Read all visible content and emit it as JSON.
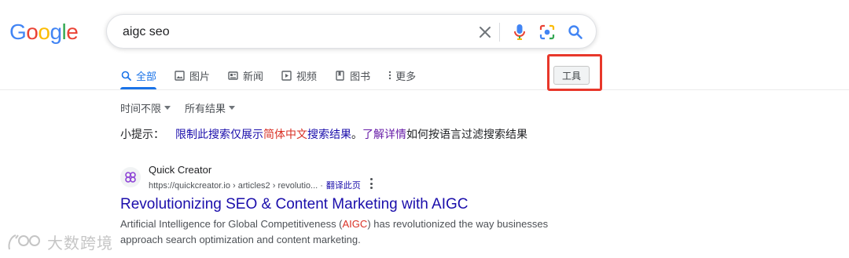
{
  "logo": {
    "letters": [
      "G",
      "o",
      "o",
      "g",
      "l",
      "e"
    ],
    "colors": [
      "#4285f4",
      "#ea4335",
      "#fbbc05",
      "#4285f4",
      "#34a853",
      "#ea4335"
    ]
  },
  "search": {
    "query": "aigc seo"
  },
  "tabs": [
    {
      "label": "全部",
      "icon": "search-icon",
      "active": true
    },
    {
      "label": "图片",
      "icon": "image-icon"
    },
    {
      "label": "新闻",
      "icon": "news-icon"
    },
    {
      "label": "视频",
      "icon": "play-icon"
    },
    {
      "label": "图书",
      "icon": "book-icon"
    },
    {
      "label": "更多",
      "icon": "more-vert-icon"
    }
  ],
  "tools": {
    "label": "工具"
  },
  "filters": {
    "time": "时间不限",
    "results": "所有结果"
  },
  "tip": {
    "prefix": "小提示：",
    "link_part1": "限制此搜索仅展示",
    "link_red": "简体中文",
    "link_part2": "搜索结果",
    "separator": "。",
    "learn_more": "了解详情",
    "suffix": "如何按语言过滤搜索结果"
  },
  "result": {
    "site_name": "Quick Creator",
    "url": "https://quickcreator.io › articles2 › revolutio... ·",
    "translate": "翻译此页",
    "title": "Revolutionizing SEO & Content Marketing with AIGC",
    "snippet_before": "Artificial Intelligence for Global Competitiveness (",
    "snippet_em": "AIGC",
    "snippet_after": ") has revolutionized the way businesses approach search optimization and content marketing."
  },
  "watermark": {
    "text": "大数跨境"
  },
  "colors": {
    "accent": "#1a73e8",
    "link": "#1a0dab",
    "highlight": "#e8372a"
  }
}
